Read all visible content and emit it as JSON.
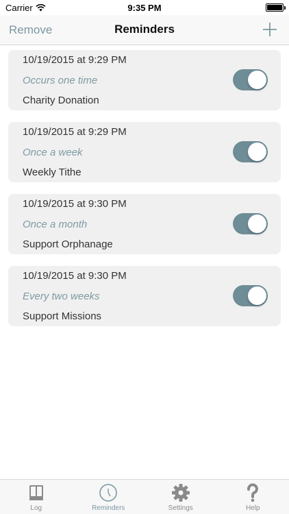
{
  "status_bar": {
    "carrier": "Carrier",
    "time": "9:35 PM"
  },
  "nav": {
    "left_label": "Remove",
    "title": "Reminders",
    "add_icon": "plus-icon"
  },
  "reminders": [
    {
      "date": "10/19/2015 at 9:29 PM",
      "frequency": "Occurs one time",
      "name": "Charity Donation",
      "enabled": true
    },
    {
      "date": "10/19/2015 at 9:29 PM",
      "frequency": "Once a week",
      "name": "Weekly Tithe",
      "enabled": true
    },
    {
      "date": "10/19/2015 at 9:30 PM",
      "frequency": "Once a month",
      "name": "Support Orphanage",
      "enabled": true
    },
    {
      "date": "10/19/2015 at 9:30 PM",
      "frequency": "Every two weeks",
      "name": "Support Missions",
      "enabled": true
    }
  ],
  "tabs": [
    {
      "label": "Log",
      "icon": "book-icon",
      "active": false
    },
    {
      "label": "Reminders",
      "icon": "clock-icon",
      "active": true
    },
    {
      "label": "Settings",
      "icon": "gear-icon",
      "active": false
    },
    {
      "label": "Help",
      "icon": "question-icon",
      "active": false
    }
  ],
  "colors": {
    "accent": "#7b98a2",
    "toggle_on": "#6e8d96",
    "card_bg": "#f0f0f0"
  }
}
